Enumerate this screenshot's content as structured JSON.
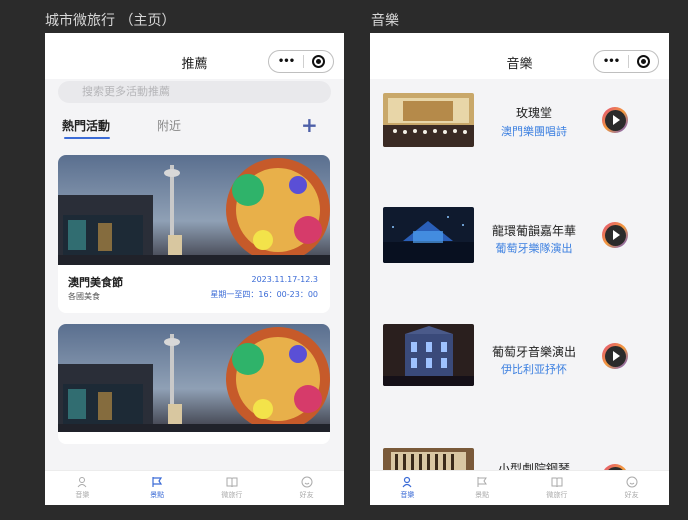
{
  "frames": {
    "left_label": "城市微旅行 （主页）",
    "right_label": "音樂"
  },
  "left": {
    "title": "推薦",
    "search_placeholder": "搜索更多活動推薦",
    "tabs": [
      {
        "label": "熱門活動",
        "active": true
      },
      {
        "label": "附近",
        "active": false
      }
    ],
    "add_icon": "plus-icon",
    "cards": [
      {
        "title": "澳門美食節",
        "subtitle": "各國美食",
        "date": "2023.11.17-12.3",
        "time": "星期一至四：16：00-23：00"
      },
      {
        "title": "",
        "subtitle": "",
        "date": "",
        "time": ""
      }
    ],
    "tabbar": [
      {
        "label": "音樂",
        "icon": "music-icon",
        "active": false
      },
      {
        "label": "景點",
        "icon": "flag-icon",
        "active": true
      },
      {
        "label": "微旅行",
        "icon": "book-icon",
        "active": false
      },
      {
        "label": "好友",
        "icon": "smile-icon",
        "active": false
      }
    ]
  },
  "right": {
    "title": "音樂",
    "items": [
      {
        "title": "玫瑰堂",
        "subtitle": "澳門樂團唱詩"
      },
      {
        "title": "龍環葡韻嘉年華",
        "subtitle": "葡萄牙樂隊演出"
      },
      {
        "title": "葡萄牙音樂演出",
        "subtitle": "伊比利亚抒怀"
      },
      {
        "title": "小型劇院鋼琴",
        "subtitle": ""
      }
    ],
    "tabbar": [
      {
        "label": "音樂",
        "icon": "music-icon",
        "active": true
      },
      {
        "label": "景點",
        "icon": "flag-icon",
        "active": false
      },
      {
        "label": "微旅行",
        "icon": "book-icon",
        "active": false
      },
      {
        "label": "好友",
        "icon": "smile-icon",
        "active": false
      }
    ]
  },
  "capsule": {
    "more_icon": "more-dots-icon",
    "close_icon": "target-close-icon"
  },
  "colors": {
    "accent": "#3b6bd6",
    "link": "#3b7fe0",
    "background": "#2b2b2b"
  }
}
